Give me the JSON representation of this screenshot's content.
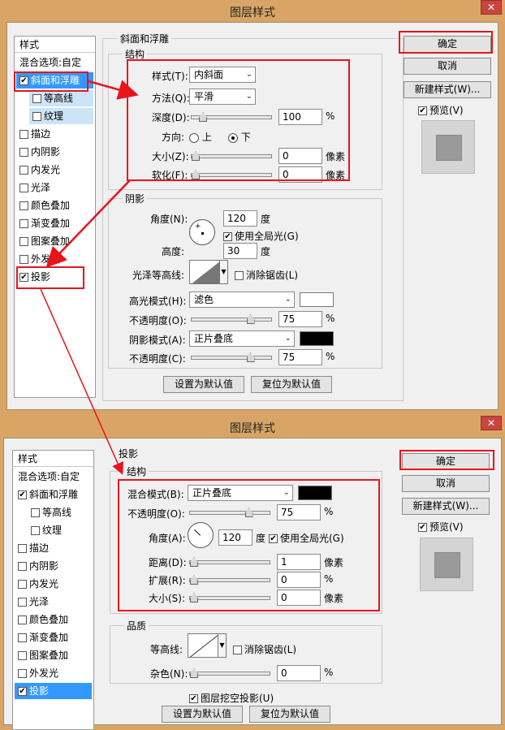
{
  "dialog1": {
    "title": "图层样式",
    "close": "✕",
    "styles_header": "样式",
    "blend_options": "混合选项:自定",
    "style_items": [
      "斜面和浮雕",
      "等高线",
      "纹理",
      "描边",
      "内阴影",
      "内发光",
      "光泽",
      "颜色叠加",
      "渐变叠加",
      "图案叠加",
      "外发光",
      "投影"
    ],
    "checked": [
      true,
      false,
      false,
      false,
      false,
      false,
      false,
      false,
      false,
      false,
      false,
      true
    ],
    "panel_title": "斜面和浮雕",
    "structure": "结构",
    "style_label": "样式(T):",
    "style_value": "内斜面",
    "technique_label": "方法(Q):",
    "technique_value": "平滑",
    "depth_label": "深度(D):",
    "depth_value": "100",
    "depth_unit": "%",
    "depth_level": 0.1,
    "direction_label": "方向:",
    "dir_up": "上",
    "dir_down": "下",
    "direction_selected": "下",
    "size_label": "大小(Z):",
    "size_value": "0",
    "size_unit": "像素",
    "size_level": 0,
    "soften_label": "软化(F):",
    "soften_value": "0",
    "soften_unit": "像素",
    "soften_level": 0,
    "shading": "阴影",
    "angle_label": "角度(N):",
    "angle_value": "120",
    "angle_unit": "度",
    "global_light": "使用全局光(G)",
    "global_light_checked": true,
    "altitude_label": "高度:",
    "altitude_value": "30",
    "altitude_unit": "度",
    "gloss_contour_label": "光泽等高线:",
    "antialiased": "消除锯齿(L)",
    "highlight_mode_label": "高光模式(H):",
    "highlight_mode": "滤色",
    "highlight_color": "#ffffff",
    "opacity_label": "不透明度(O):",
    "highlight_opacity": "75",
    "opacity_unit": "%",
    "highlight_opacity_level": 0.75,
    "shadow_mode_label": "阴影模式(A):",
    "shadow_mode": "正片叠底",
    "shadow_color": "#000000",
    "opacity2_label": "不透明度(C):",
    "shadow_opacity": "75",
    "shadow_opacity_level": 0.75,
    "make_default": "设置为默认值",
    "reset_default": "复位为默认值",
    "ok": "确定",
    "cancel": "取消",
    "new_style": "新建样式(W)...",
    "preview": "预览(V)"
  },
  "dialog2": {
    "title": "图层样式",
    "close": "✕",
    "styles_header": "样式",
    "blend_options": "混合选项:自定",
    "style_items": [
      "斜面和浮雕",
      "等高线",
      "纹理",
      "描边",
      "内阴影",
      "内发光",
      "光泽",
      "颜色叠加",
      "渐变叠加",
      "图案叠加",
      "外发光",
      "投影"
    ],
    "checked": [
      true,
      false,
      false,
      false,
      false,
      false,
      false,
      false,
      false,
      false,
      false,
      true
    ],
    "panel_title": "投影",
    "structure": "结构",
    "blend_mode_label": "混合模式(B):",
    "blend_mode": "正片叠底",
    "blend_color": "#000000",
    "opacity_label": "不透明度(O):",
    "opacity_value": "75",
    "opacity_unit": "%",
    "opacity_level": 0.75,
    "angle_label": "角度(A):",
    "angle_value": "120",
    "angle_unit": "度",
    "global_light": "使用全局光(G)",
    "global_light_checked": true,
    "distance_label": "距离(D):",
    "distance_value": "1",
    "distance_unit": "像素",
    "distance_level": 0.0,
    "spread_label": "扩展(R):",
    "spread_value": "0",
    "spread_unit": "%",
    "spread_level": 0,
    "size_label": "大小(S):",
    "size_value": "0",
    "size_unit": "像素",
    "size_level": 0,
    "quality": "品质",
    "contour_label": "等高线:",
    "antialiased": "消除锯齿(L)",
    "noise_label": "杂色(N):",
    "noise_value": "0",
    "noise_unit": "%",
    "noise_level": 0,
    "knockout": "图层挖空投影(U)",
    "knockout_checked": true,
    "make_default": "设置为默认值",
    "reset_default": "复位为默认值",
    "ok": "确定",
    "cancel": "取消",
    "new_style": "新建样式(W)...",
    "preview": "预览(V)"
  },
  "colors": {
    "annotation_red": "#e8141c",
    "selection_blue": "#3399ff",
    "title_bg": "#d9a566"
  }
}
